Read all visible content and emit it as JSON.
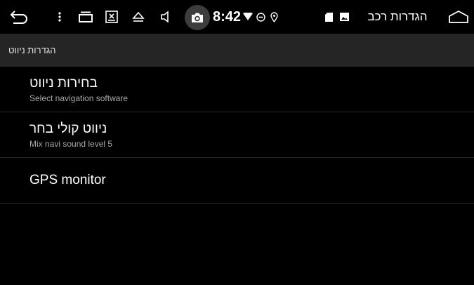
{
  "status_bar": {
    "time": "8:42",
    "car_settings_title": "הגדרות רכב",
    "icons": [
      "back-icon",
      "more-icon",
      "recent-apps-icon",
      "close-window-icon",
      "eject-icon",
      "volume-icon",
      "camera-icon",
      "wifi-icon",
      "do-not-disturb-icon",
      "location-icon",
      "sd-card-icon",
      "image-icon",
      "home-icon"
    ]
  },
  "app_bar": {
    "title": "הגדרות ניווט"
  },
  "settings": [
    {
      "title": "בחירות ניווט",
      "subtitle": "Select navigation software"
    },
    {
      "title": "ניווט קולי בחר",
      "subtitle": "Mix navi sound level 5"
    },
    {
      "title": "GPS monitor",
      "subtitle": ""
    }
  ]
}
